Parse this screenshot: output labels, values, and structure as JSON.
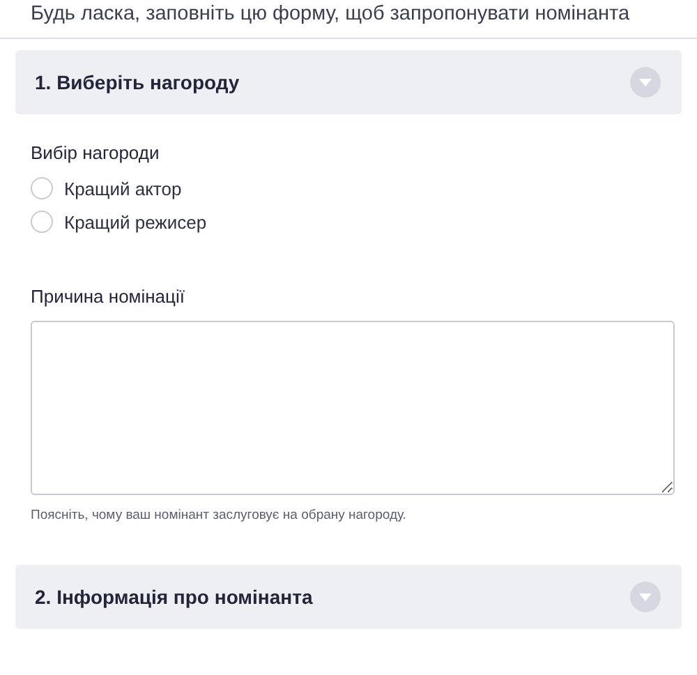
{
  "intro": "Будь ласка, заповніть цю форму, щоб запропонувати номінанта",
  "section_1": {
    "title": "1. Виберіть нагороду"
  },
  "award_choice": {
    "label": "Вибір нагороди",
    "options": [
      {
        "label": "Кращий актор",
        "selected": false
      },
      {
        "label": "Кращий режисер",
        "selected": false
      }
    ]
  },
  "reason": {
    "label": "Причина номінації",
    "hint": "Поясніть, чому ваш номінант заслуговує на обрану нагороду."
  },
  "section_2": {
    "title": "2. Інформація про номінанта"
  }
}
